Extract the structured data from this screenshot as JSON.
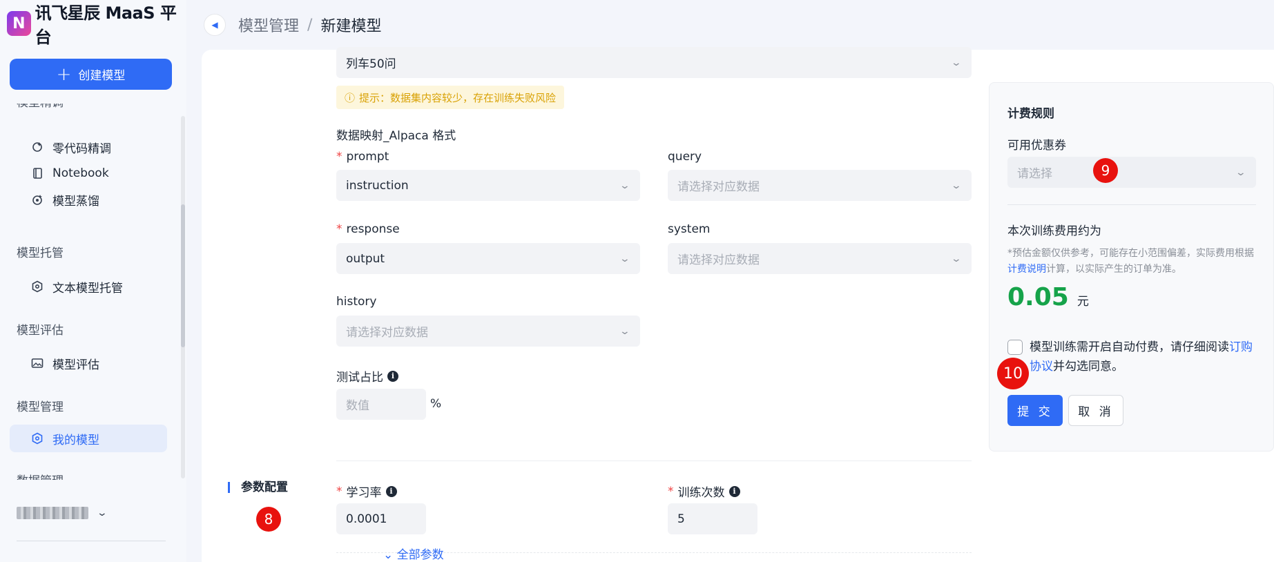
{
  "brand": {
    "mark": "N",
    "name": "讯飞星辰 MaaS 平台"
  },
  "sidebar": {
    "create_label": "创建模型",
    "partial_top_group": "模型精调",
    "items_group1": [
      {
        "label": "零代码精调",
        "icon": "sparkle-gear-icon"
      },
      {
        "label": "Notebook",
        "icon": "notebook-icon"
      },
      {
        "label": "模型蒸馏",
        "icon": "distill-icon"
      }
    ],
    "group2": "模型托管",
    "item_hosting": "文本模型托管",
    "group3": "模型评估",
    "item_eval": "模型评估",
    "group4": "模型管理",
    "item_mymodel": "我的模型",
    "partial_bottom_group": "数据管理"
  },
  "breadcrumb": {
    "parent": "模型管理",
    "separator": "/",
    "current": "新建模型"
  },
  "form": {
    "dataset_value": "列车50问",
    "hint": "提示：数据集内容较少，存在训练失败风险",
    "mapping_title": "数据映射_Alpaca 格式",
    "prompt_label": "prompt",
    "prompt_value": "instruction",
    "query_label": "query",
    "query_placeholder": "请选择对应数据",
    "response_label": "response",
    "response_value": "output",
    "system_label": "system",
    "system_placeholder": "请选择对应数据",
    "history_label": "history",
    "history_placeholder": "请选择对应数据",
    "test_ratio_label": "测试占比",
    "test_ratio_placeholder": "数值",
    "percent": "%",
    "section_title": "参数配置",
    "lr_label": "学习率",
    "lr_value": "0.0001",
    "epochs_label": "训练次数",
    "epochs_value": "5",
    "all_params": "全部参数"
  },
  "billing": {
    "title": "计费规则",
    "coupon_label": "可用优惠券",
    "coupon_placeholder": "请选择",
    "cost_label": "本次训练费用约为",
    "note_prefix": "*预估金额仅供参考，可能存在小范围偏差，实际费用根据",
    "note_link": "计费说明",
    "note_suffix": "计算，以实际产生的订单为准。",
    "price": "0.05",
    "unit": "元",
    "agree_prefix": "模型训练需开启自动付费，请仔细阅读",
    "agree_link": "订购协议",
    "agree_suffix": "并勾选同意。",
    "submit": "提 交",
    "cancel": "取 消"
  },
  "badges": {
    "b8": "8",
    "b9": "9",
    "b10": "10"
  }
}
